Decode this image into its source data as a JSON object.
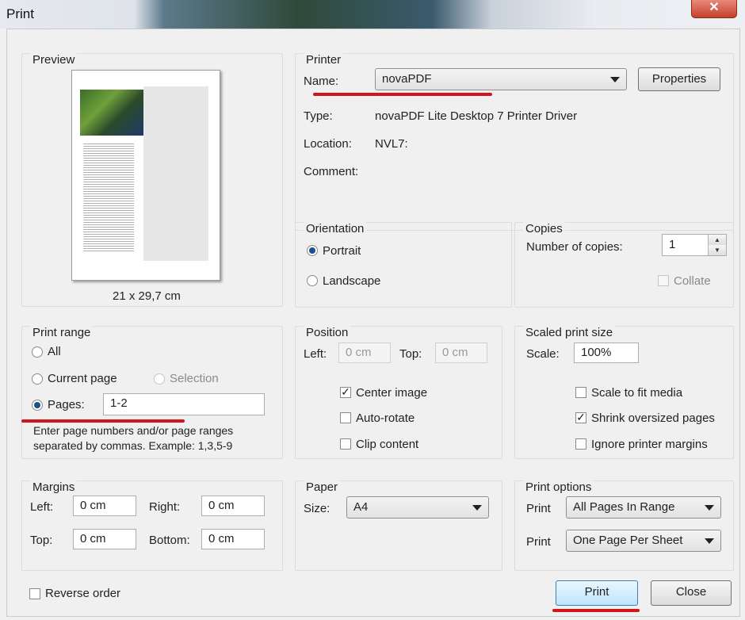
{
  "window": {
    "title": "Print",
    "close_glyph": "✕"
  },
  "preview": {
    "label": "Preview",
    "size": "21 x 29,7 cm"
  },
  "printer": {
    "label": "Printer",
    "name_label": "Name:",
    "name_value": "novaPDF",
    "properties_button": "Properties",
    "type_label": "Type:",
    "type_value": "novaPDF Lite Desktop 7 Printer Driver",
    "location_label": "Location:",
    "location_value": "NVL7:",
    "comment_label": "Comment:",
    "comment_value": ""
  },
  "orientation": {
    "label": "Orientation",
    "portrait": "Portrait",
    "landscape": "Landscape",
    "selected": "portrait"
  },
  "copies": {
    "label": "Copies",
    "number_label": "Number of copies:",
    "number_value": "1",
    "collate": "Collate",
    "collate_checked": false
  },
  "print_range": {
    "label": "Print range",
    "all": "All",
    "current_page": "Current page",
    "selection": "Selection",
    "pages": "Pages:",
    "pages_value": "1-2",
    "hint_line1": "Enter page numbers and/or page ranges",
    "hint_line2": "separated by commas. Example: 1,3,5-9",
    "selected": "pages"
  },
  "position": {
    "label": "Position",
    "left_label": "Left:",
    "left_value": "0 cm",
    "top_label": "Top:",
    "top_value": "0 cm",
    "center_image": "Center image",
    "center_image_checked": true,
    "auto_rotate": "Auto-rotate",
    "auto_rotate_checked": false,
    "clip_content": "Clip content",
    "clip_content_checked": false
  },
  "scaled": {
    "label": "Scaled print size",
    "scale_label": "Scale:",
    "scale_value": "100%",
    "scale_to_fit": "Scale to fit media",
    "scale_to_fit_checked": false,
    "shrink": "Shrink oversized pages",
    "shrink_checked": true,
    "ignore_margins": "Ignore printer margins",
    "ignore_margins_checked": false
  },
  "margins": {
    "label": "Margins",
    "left_label": "Left:",
    "left_value": "0 cm",
    "right_label": "Right:",
    "right_value": "0 cm",
    "top_label": "Top:",
    "top_value": "0 cm",
    "bottom_label": "Bottom:",
    "bottom_value": "0 cm"
  },
  "paper": {
    "label": "Paper",
    "size_label": "Size:",
    "size_value": "A4"
  },
  "print_options": {
    "label": "Print options",
    "print_label_1": "Print",
    "print_value_1": "All Pages In Range",
    "print_label_2": "Print",
    "print_value_2": "One Page Per Sheet"
  },
  "footer": {
    "reverse_order": "Reverse order",
    "reverse_order_checked": false,
    "print_button": "Print",
    "close_button": "Close"
  },
  "colors": {
    "annotation_red": "#d2141c",
    "default_button": "#bee6fd"
  }
}
